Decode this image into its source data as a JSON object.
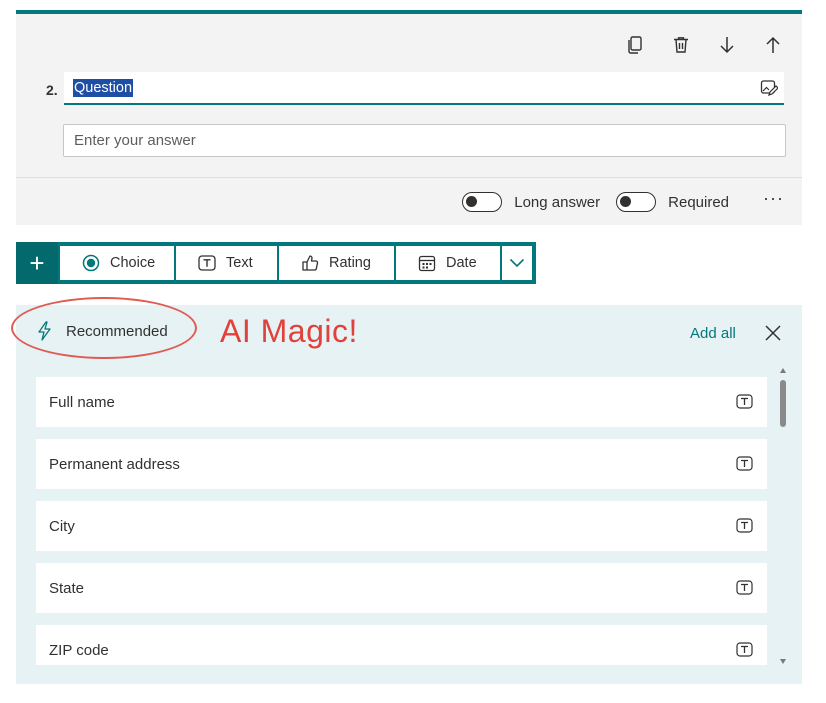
{
  "question": {
    "number": "2.",
    "title": "Question",
    "answer_placeholder": "Enter your answer",
    "toolbar_icons": [
      "copy-icon",
      "delete-icon",
      "move-down-icon",
      "move-up-icon"
    ],
    "long_answer_label": "Long answer",
    "required_label": "Required",
    "long_answer_on": false,
    "required_on": false,
    "more_label": "···"
  },
  "add_bar": {
    "plus_label": "+",
    "buttons": [
      {
        "label": "Choice",
        "icon": "radio-icon"
      },
      {
        "label": "Text",
        "icon": "text-icon"
      },
      {
        "label": "Rating",
        "icon": "thumb-icon"
      },
      {
        "label": "Date",
        "icon": "calendar-icon"
      }
    ],
    "more_icon": "chevron-down-icon"
  },
  "recommended": {
    "label": "Recommended",
    "annotation": "AI Magic!",
    "add_all_label": "Add all",
    "items": [
      {
        "label": "Full name"
      },
      {
        "label": "Permanent address"
      },
      {
        "label": "City"
      },
      {
        "label": "State"
      },
      {
        "label": "ZIP code"
      }
    ]
  },
  "colors": {
    "accent": "#03787c",
    "annotation": "#e0413a",
    "selection": "#1e4fa5",
    "panel_bg": "#e6f2f3"
  }
}
